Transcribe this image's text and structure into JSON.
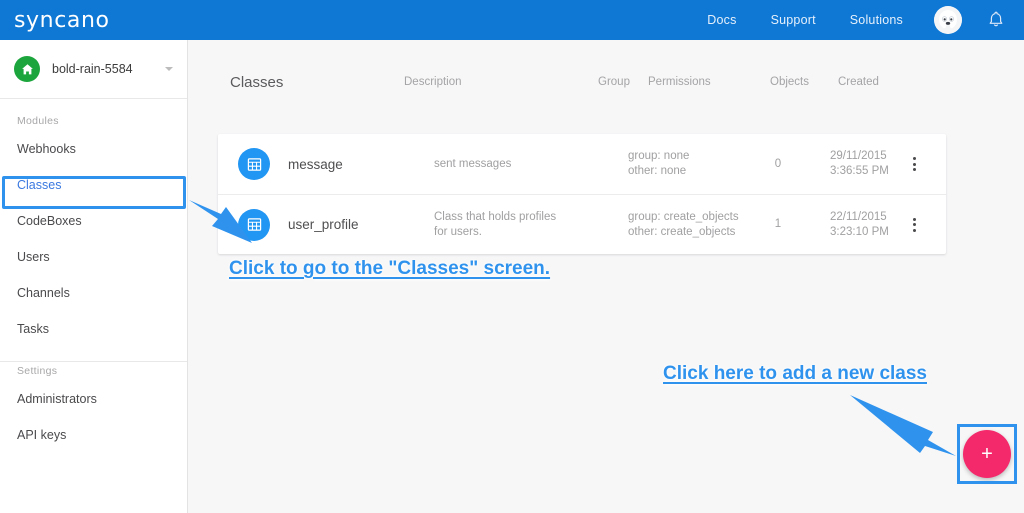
{
  "topbar": {
    "logo": "syncano",
    "links": [
      {
        "label": "Docs"
      },
      {
        "label": "Support"
      },
      {
        "label": "Solutions"
      }
    ],
    "avatar_name": "user-avatar",
    "bell_name": "notifications-bell-icon",
    "brand_color": "#0f77d4"
  },
  "sidebar": {
    "project": {
      "name": "bold-rain-5584",
      "home_icon": "home-icon",
      "home_color": "#1ba53c",
      "caret_icon": "chevron-down-icon"
    },
    "sections": [
      {
        "label": "Modules",
        "items": [
          {
            "label": "Webhooks",
            "active": false
          },
          {
            "label": "Classes",
            "active": true
          },
          {
            "label": "CodeBoxes",
            "active": false
          },
          {
            "label": "Users",
            "active": false
          },
          {
            "label": "Channels",
            "active": false
          },
          {
            "label": "Tasks",
            "active": false
          }
        ]
      },
      {
        "label": "Settings",
        "items": [
          {
            "label": "Administrators",
            "active": false
          },
          {
            "label": "API keys",
            "active": false
          }
        ]
      }
    ]
  },
  "main": {
    "columns": {
      "title": "Classes",
      "description": "Description",
      "group": "Group",
      "permissions": "Permissions",
      "objects": "Objects",
      "created": "Created"
    },
    "rows": [
      {
        "icon": "class-grid-icon",
        "name": "message",
        "description": "sent messages",
        "group": "",
        "permissions_group": "group: none",
        "permissions_other": "other: none",
        "objects": "0",
        "created_date": "29/11/2015",
        "created_time": "3:36:55 PM",
        "menu_icon": "overflow-menu-icon"
      },
      {
        "icon": "class-grid-icon",
        "name": "user_profile",
        "description": "Class that holds profiles for users.",
        "group": "",
        "permissions_group": "group: create_objects",
        "permissions_other": "other: create_objects",
        "objects": "1",
        "created_date": "22/11/2015",
        "created_time": "3:23:10 PM",
        "menu_icon": "overflow-menu-icon"
      }
    ],
    "fab": {
      "label": "+",
      "color": "#f4296b",
      "name": "add-new-class-button"
    }
  },
  "annotations": {
    "classes_hint": "Click to go to the \"Classes\" screen.",
    "add_class_hint": "Click here to add a new class",
    "color": "#2f93ee"
  }
}
